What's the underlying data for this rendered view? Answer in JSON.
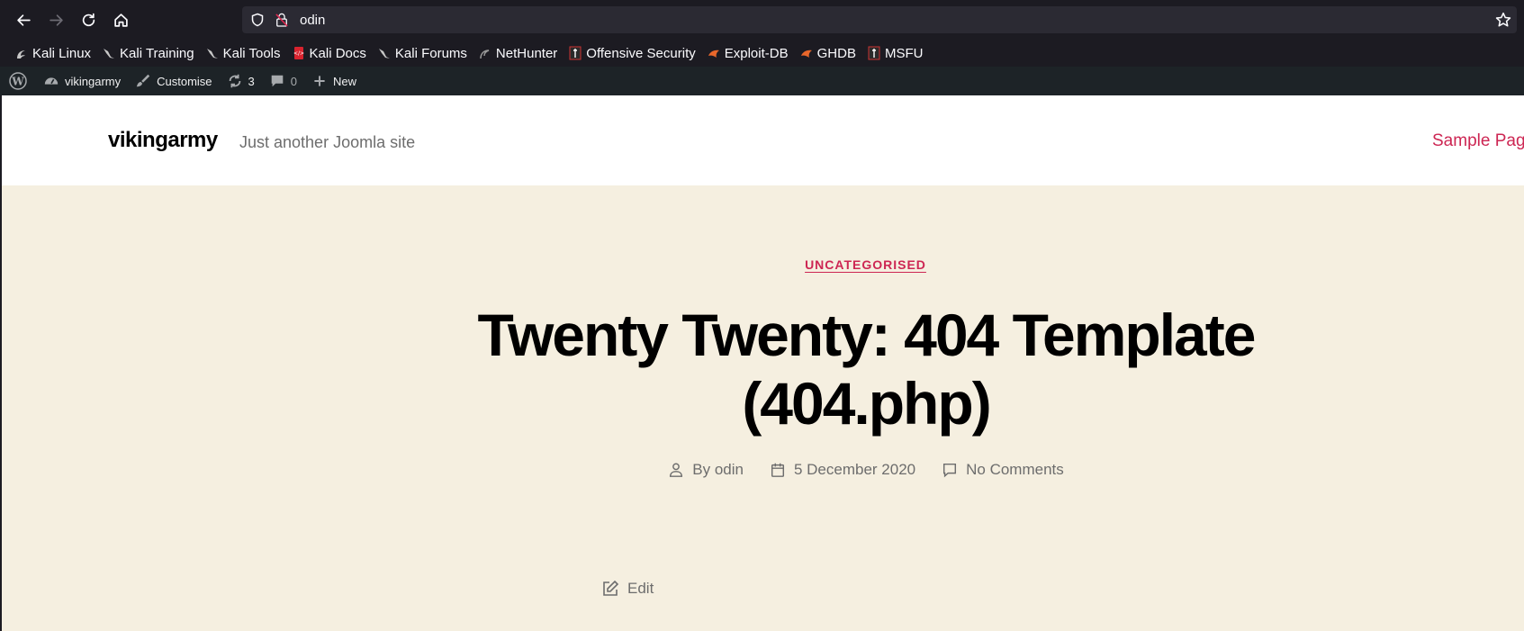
{
  "browser": {
    "url": "odin",
    "bookmarks": [
      {
        "label": "Kali Linux",
        "icon": "kali-dragon-icon"
      },
      {
        "label": "Kali Training",
        "icon": "kali-dragon-icon"
      },
      {
        "label": "Kali Tools",
        "icon": "kali-dragon-icon"
      },
      {
        "label": "Kali Docs",
        "icon": "kali-docs-icon"
      },
      {
        "label": "Kali Forums",
        "icon": "kali-dragon-icon"
      },
      {
        "label": "NetHunter",
        "icon": "nethunter-icon"
      },
      {
        "label": "Offensive Security",
        "icon": "offsec-icon"
      },
      {
        "label": "Exploit-DB",
        "icon": "exploitdb-icon"
      },
      {
        "label": "GHDB",
        "icon": "exploitdb-icon"
      },
      {
        "label": "MSFU",
        "icon": "offsec-icon"
      }
    ]
  },
  "adminbar": {
    "site_name": "vikingarmy",
    "customise": "Customise",
    "updates_count": "3",
    "comments_count": "0",
    "new_label": "New"
  },
  "site": {
    "title": "vikingarmy",
    "description": "Just another Joomla site",
    "nav_item": "Sample Page"
  },
  "post": {
    "category": "UNCATEGORISED",
    "title": "Twenty Twenty: 404 Template (404.php)",
    "author_prefix": "By",
    "author": "odin",
    "date": "5 December 2020",
    "comments": "No Comments",
    "edit_label": "Edit"
  },
  "colors": {
    "accent": "#cd2653",
    "page_bg": "#f5efe0",
    "adminbar_bg": "#1d2327",
    "browser_bg": "#1c1b22"
  }
}
